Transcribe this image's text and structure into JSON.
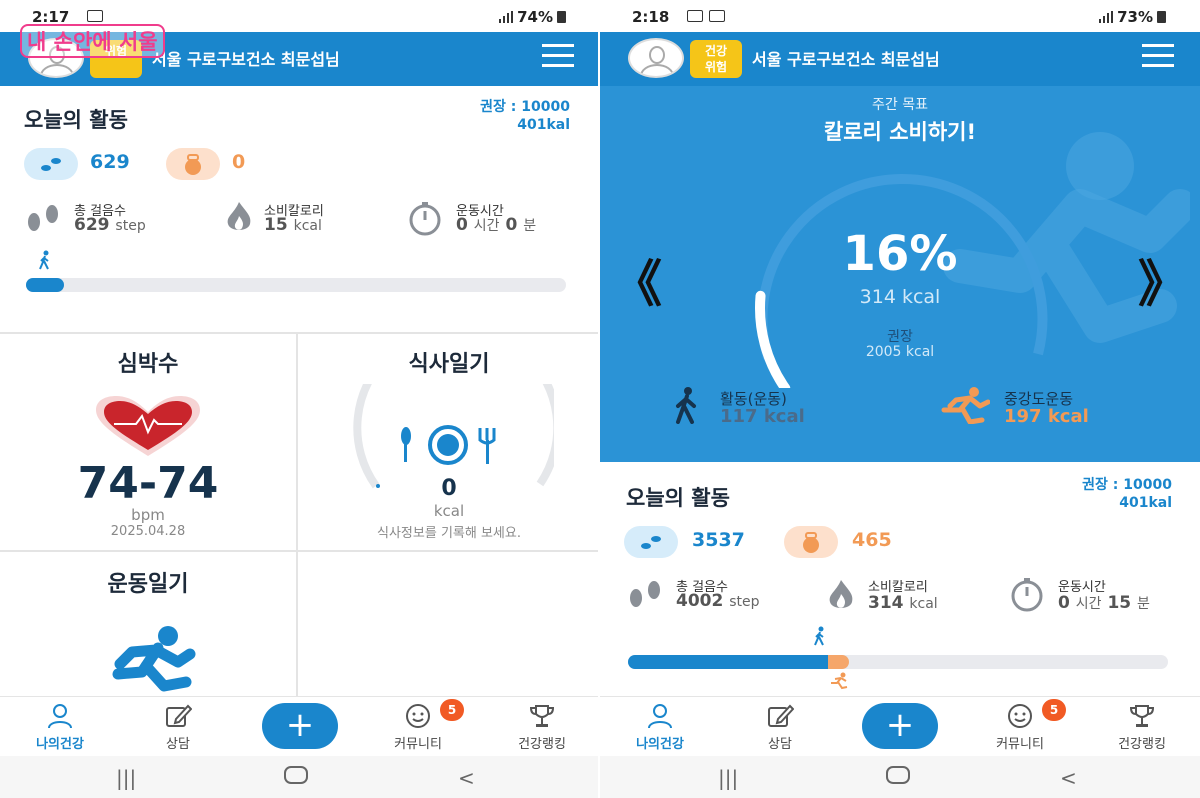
{
  "watermark": "내 손안에 서울",
  "left": {
    "status": {
      "time": "2:17",
      "battery": "74%"
    },
    "header": {
      "badge_line1": "",
      "badge_line2": "위험",
      "title": "서울 구로구보건소 최문섭님"
    },
    "activity": {
      "title": "오늘의 활동",
      "recommend_steps": "권장 : 10000",
      "recommend_kcal": "401kal",
      "steps_pill": "629",
      "kcal_pill": "0",
      "total_steps_label": "총 걸음수",
      "total_steps_value": "629",
      "total_steps_unit": "step",
      "calories_label": "소비칼로리",
      "calories_value": "15",
      "calories_unit": "kcal",
      "time_label": "운동시간",
      "time_hours": "0",
      "time_hours_unit": "시간",
      "time_minutes": "0",
      "time_minutes_unit": "분",
      "progress": 0.07
    },
    "heart": {
      "title": "심박수",
      "value": "74-74",
      "unit": "bpm",
      "date": "2025.04.28"
    },
    "meal": {
      "title": "식사일기",
      "value": "0",
      "unit": "kcal",
      "hint": "식사정보를 기록해 보세요."
    },
    "exercise": {
      "title": "운동일기"
    },
    "nav": {
      "my_health": "나의건강",
      "counsel": "상담",
      "plus": "+",
      "community": "커뮤니티",
      "community_badge": "5",
      "ranking": "건강랭킹"
    }
  },
  "right": {
    "status": {
      "time": "2:18",
      "battery": "73%"
    },
    "header": {
      "badge_line1": "건강",
      "badge_line2": "위험",
      "title": "서울 구로구보건소 최문섭님"
    },
    "goal": {
      "subtitle": "주간 목표",
      "title": "칼로리 소비하기!",
      "percent": "16%",
      "percent_value": 0.16,
      "kcal": "314 kcal",
      "recommend_label": "권장",
      "recommend_value": "2005 kcal",
      "activity_label": "활동(운동)",
      "activity_value": "117 kcal",
      "moderate_label": "중강도운동",
      "moderate_value": "197 kcal",
      "prev_arrow": "《",
      "next_arrow": "》"
    },
    "activity": {
      "title": "오늘의 활동",
      "recommend_steps": "권장 : 10000",
      "recommend_kcal": "401kal",
      "steps_pill": "3537",
      "kcal_pill": "465",
      "total_steps_label": "총 걸음수",
      "total_steps_value": "4002",
      "total_steps_unit": "step",
      "calories_label": "소비칼로리",
      "calories_value": "314",
      "calories_unit": "kcal",
      "time_label": "운동시간",
      "time_hours": "0",
      "time_hours_unit": "시간",
      "time_minutes": "15",
      "time_minutes_unit": "분",
      "progress": 0.37,
      "progress_moderate": 0.04
    },
    "nav": {
      "my_health": "나의건강",
      "counsel": "상담",
      "plus": "+",
      "community": "커뮤니티",
      "community_badge": "5",
      "ranking": "건강랭킹"
    }
  },
  "colors": {
    "brand": "#1a86cc",
    "accent_orange": "#f29a55",
    "badge_yellow": "#f5c518",
    "badge_red": "#f15a24",
    "heart": "#c9252c"
  }
}
